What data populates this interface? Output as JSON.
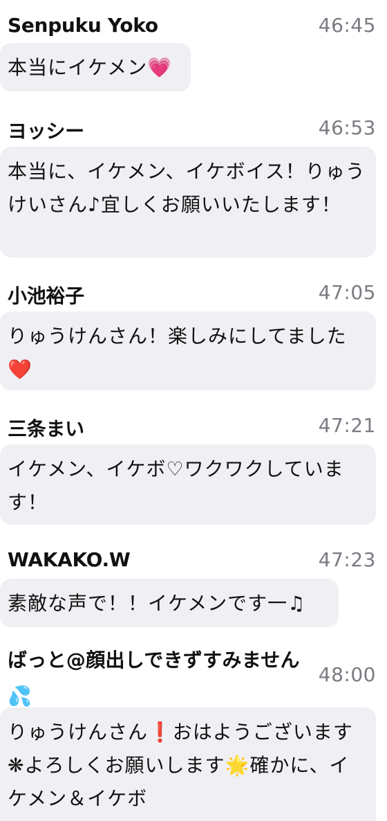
{
  "messages": [
    {
      "name": "Senpuku Yoko",
      "time": "46:45",
      "text": "本当にイケメン💗"
    },
    {
      "name": "ヨッシー",
      "time": "46:53",
      "text": "本当に、イケメン、イケボイス！りゅうけいさん♪宜しくお願いいたします！"
    },
    {
      "name": "小池裕子",
      "time": "47:05",
      "text": "りゅうけんさん！楽しみにしてました❤️"
    },
    {
      "name": "三条まい",
      "time": "47:21",
      "text": "イケメン、イケボ♡ワクワクしています！"
    },
    {
      "name": "WAKAKO.W",
      "time": "47:23",
      "text": "素敵な声で！！イケメンです一♫"
    },
    {
      "name": "ばっと@顔出しできずすみません💦",
      "time": "48:00",
      "text": "りゅうけんさん❗おはようございます❋よろしくお願いします🌟確かに、イケメン＆イケボ"
    }
  ]
}
